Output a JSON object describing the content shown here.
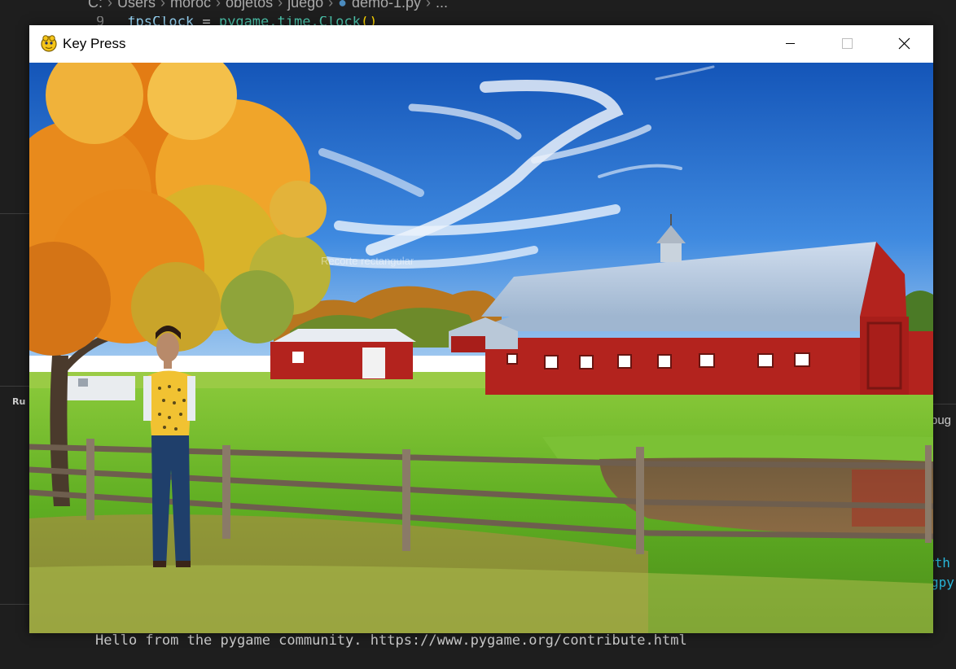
{
  "editor": {
    "breadcrumb": [
      "C:",
      "Users",
      "moroc",
      "objetos",
      "juego",
      "demo-1.py",
      "..."
    ],
    "code_line_number": "9",
    "code_text_var": "fpsClock",
    "code_text_eq": " = ",
    "code_text_fn": "pygame.time.Clock",
    "code_text_paren": "()",
    "run_label": "Ru",
    "right_text_1": "bug",
    "right_text_2": "yth",
    "right_text_3": "gpy",
    "terminal_output": "Hello from the pygame community. https://www.pygame.org/contribute.html"
  },
  "window": {
    "title": "Key Press",
    "controls": {
      "minimize": "minimize-icon",
      "maximize": "maximize-icon",
      "close": "close-icon"
    }
  },
  "scene": {
    "overlay_text": "Recorte rectangular",
    "elements": [
      "sky",
      "clouds",
      "autumn-tree",
      "barn",
      "shed",
      "fence",
      "pond",
      "grass",
      "person-sprite"
    ]
  },
  "colors": {
    "sky": "#1f6fd0",
    "barn_red": "#b3231e",
    "roof": "#b9cbe0",
    "grass": "#6bb52a",
    "foliage": "#e8881a"
  }
}
